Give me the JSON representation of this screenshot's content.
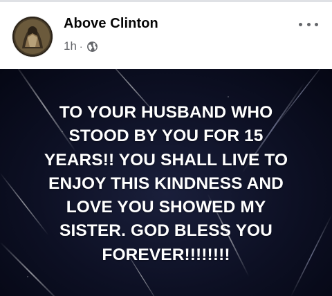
{
  "post": {
    "author_name": "Above Clinton",
    "time": "1h",
    "separator": "·",
    "audience_icon": "globe-icon",
    "more_icon": "more-horizontal-icon",
    "avatar_icon": "profile-avatar",
    "text_lines": [
      "TO  YOUR HUSBAND WHO",
      "STOOD BY YOU FOR 15",
      "YEARS!!  YOU SHALL LIVE TO",
      "ENJOY THIS KINDNESS AND",
      "LOVE YOU SHOWED MY",
      "SISTER. GOD BLESS YOU",
      "FOREVER!!!!!!!!"
    ]
  },
  "colors": {
    "author": "#050505",
    "meta": "#65676b",
    "card_background": "#0d1024",
    "card_text": "#ffffff"
  }
}
